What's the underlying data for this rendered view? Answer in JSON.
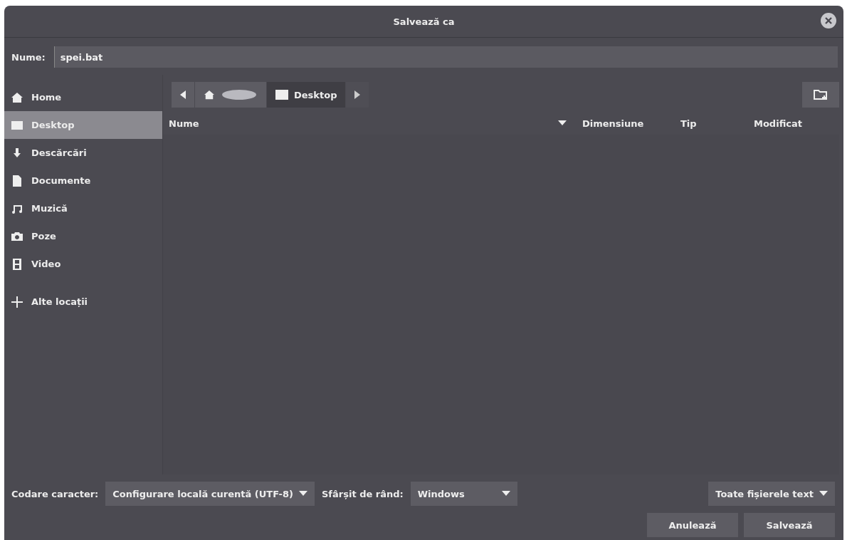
{
  "window": {
    "title": "Salvează ca"
  },
  "name_field": {
    "label": "Nume:",
    "value": "spei.bat"
  },
  "sidebar": {
    "items": [
      {
        "label": "Home",
        "kind": "home",
        "selected": false
      },
      {
        "label": "Desktop",
        "kind": "desktop",
        "selected": true
      },
      {
        "label": "Descărcări",
        "kind": "download",
        "selected": false
      },
      {
        "label": "Documente",
        "kind": "document",
        "selected": false
      },
      {
        "label": "Muzică",
        "kind": "music",
        "selected": false
      },
      {
        "label": "Poze",
        "kind": "camera",
        "selected": false
      },
      {
        "label": "Video",
        "kind": "film",
        "selected": false
      }
    ],
    "other": {
      "label": "Alte locații"
    }
  },
  "path_bar": {
    "segments": [
      {
        "kind": "home",
        "selected": false
      },
      {
        "kind": "folder",
        "label": "Desktop",
        "selected": true
      }
    ]
  },
  "table": {
    "columns": [
      {
        "label": "Nume",
        "sorted": true
      },
      {
        "label": "Dimensiune",
        "sorted": false
      },
      {
        "label": "Tip",
        "sorted": false
      },
      {
        "label": "Modificat",
        "sorted": false
      }
    ]
  },
  "encoding": {
    "label": "Codare caracter:",
    "value": "Configurare locală curentă (UTF-8)"
  },
  "line_ending": {
    "label": "Sfârșit de rând:",
    "value": "Windows"
  },
  "filter": {
    "value": "Toate fișierele text"
  },
  "buttons": [
    {
      "label": "Anulează"
    },
    {
      "label": "Salvează"
    }
  ]
}
